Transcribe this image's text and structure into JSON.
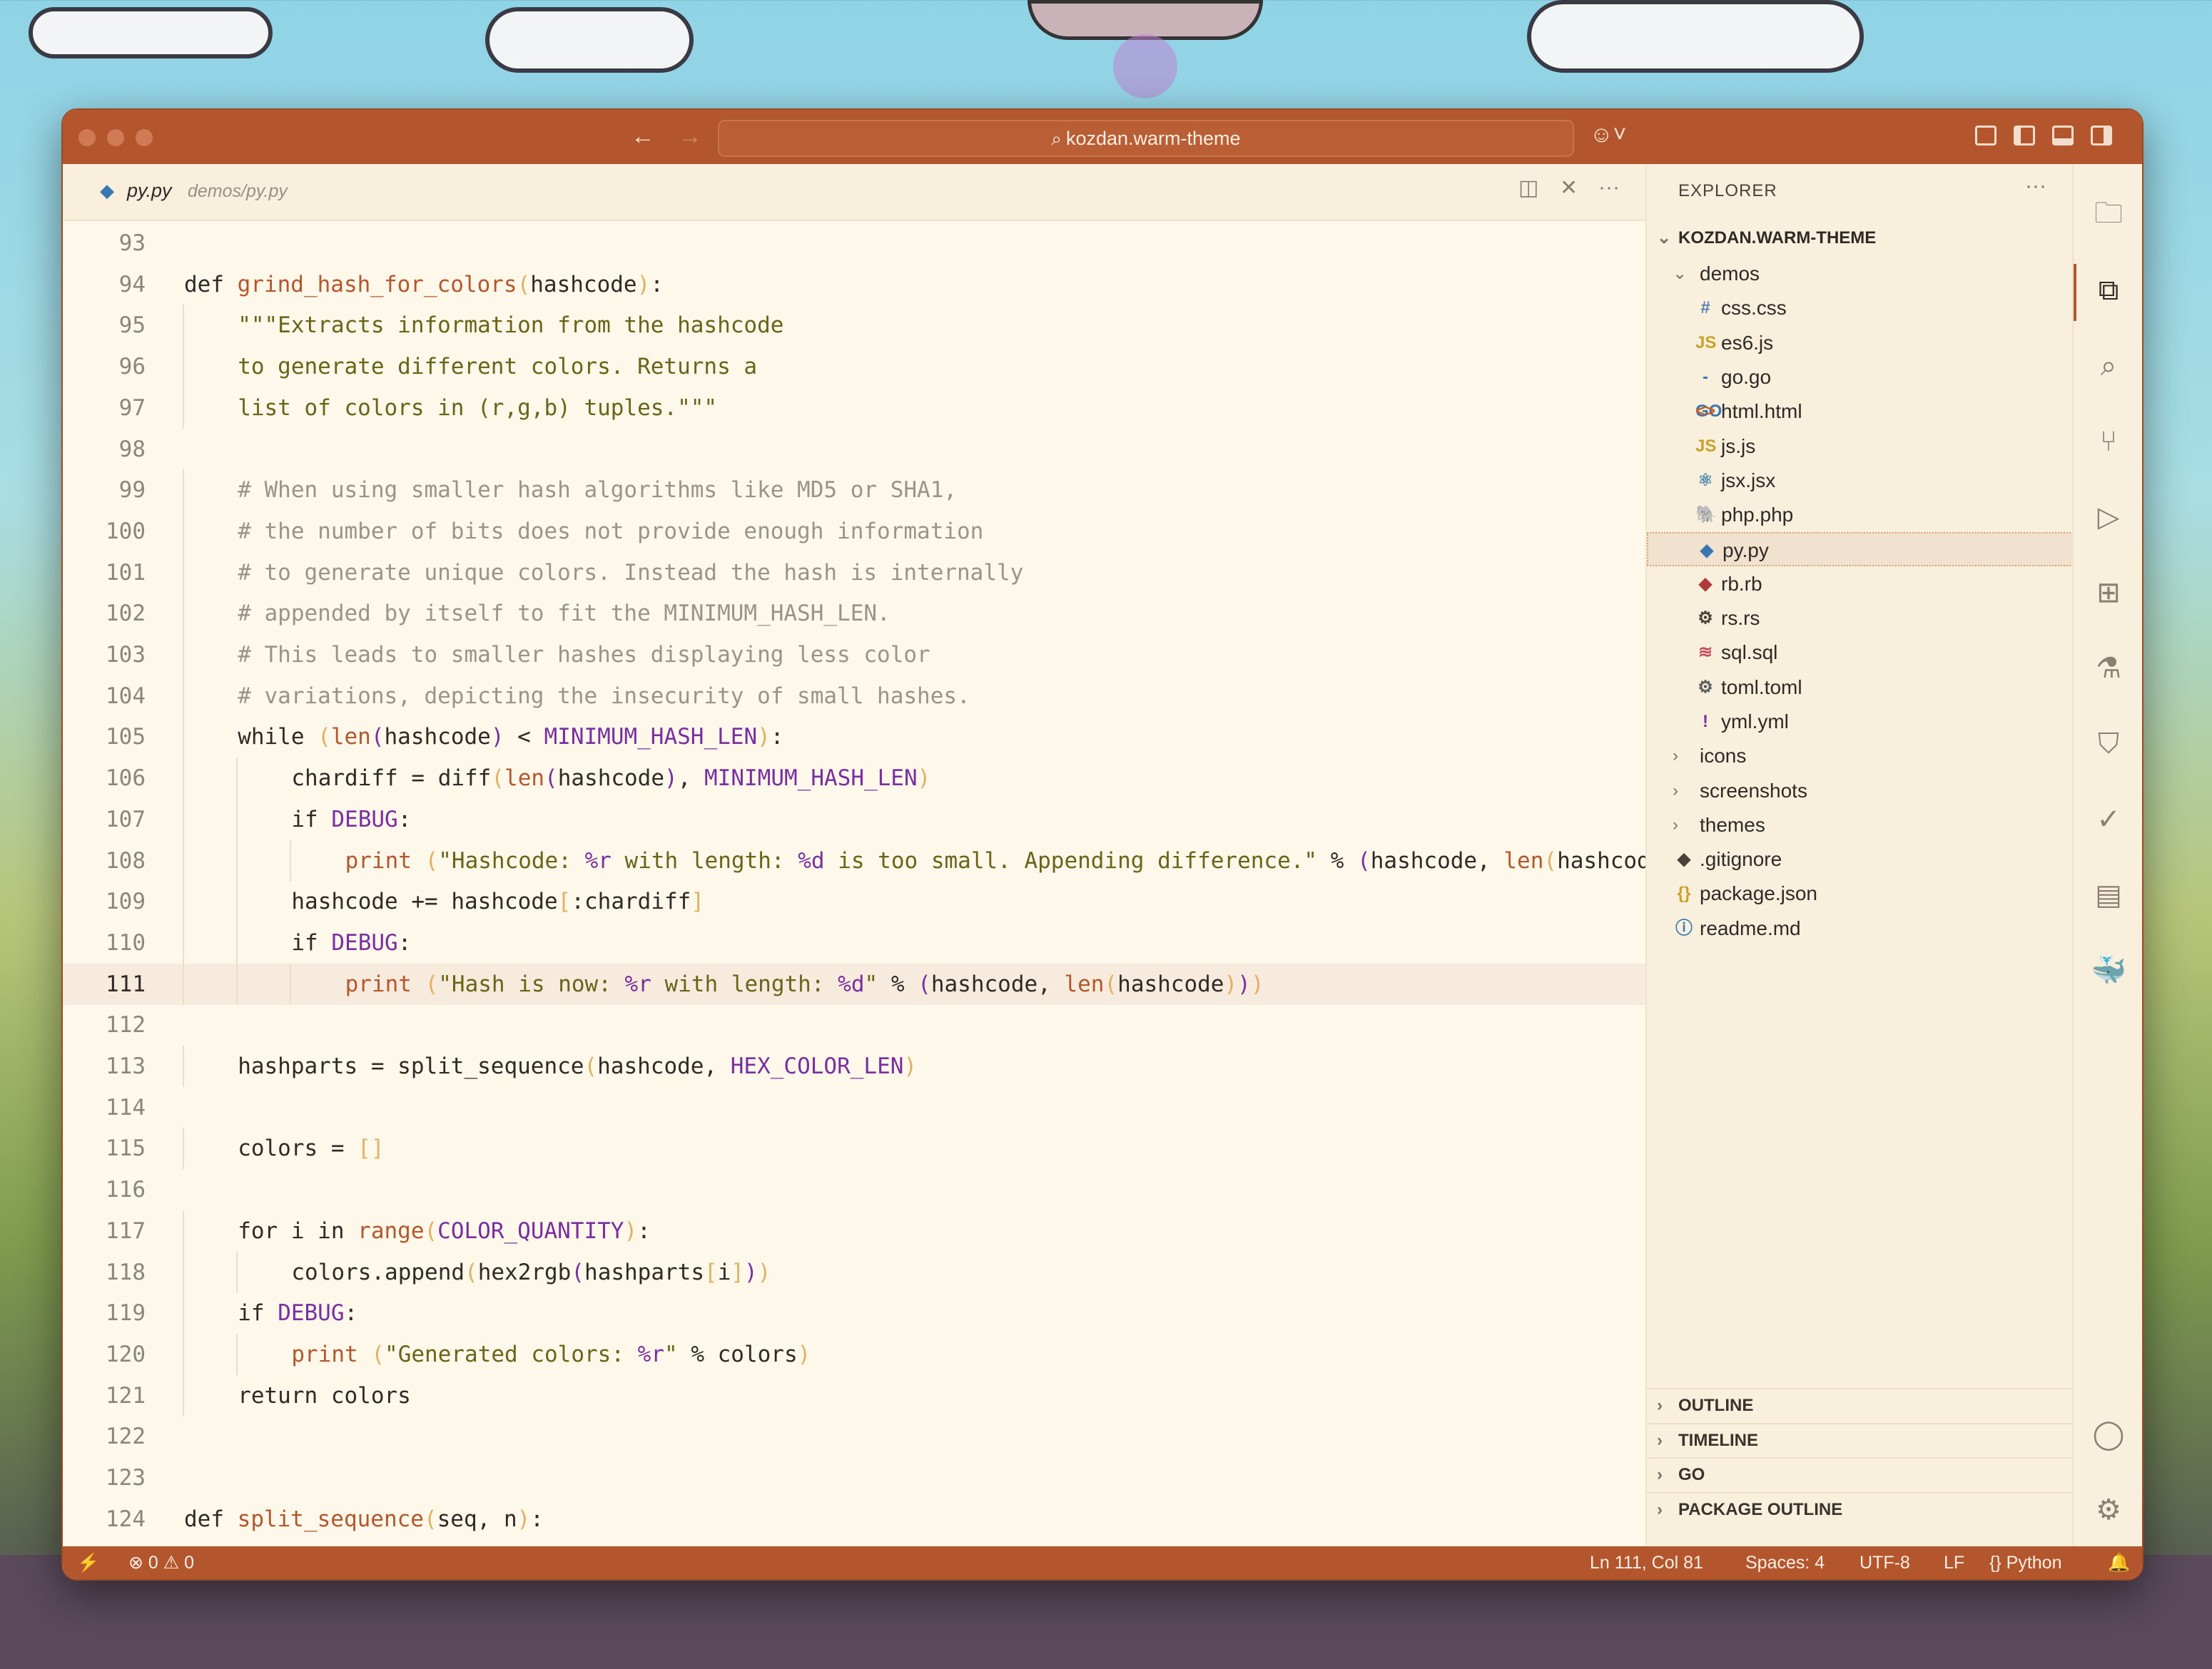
{
  "window": {
    "command_center": "kozdan.warm-theme"
  },
  "editor": {
    "tab": {
      "name": "py.py",
      "path": "demos/py.py"
    },
    "lines": [
      {
        "n": "93",
        "indent": 0,
        "segs": []
      },
      {
        "n": "94",
        "indent": 0,
        "segs": [
          [
            "k",
            "def "
          ],
          [
            "fn",
            "grind_hash_for_colors"
          ],
          [
            "br",
            "("
          ],
          [
            "pl",
            "hashcode"
          ],
          [
            "br",
            ")"
          ],
          [
            "pl",
            ":"
          ]
        ]
      },
      {
        "n": "95",
        "indent": 1,
        "segs": [
          [
            "st",
            "\"\"\"Extracts information from the hashcode"
          ]
        ]
      },
      {
        "n": "96",
        "indent": 1,
        "segs": [
          [
            "st",
            "to generate different colors. Returns a"
          ]
        ]
      },
      {
        "n": "97",
        "indent": 1,
        "segs": [
          [
            "st",
            "list of colors in (r,g,b) tuples.\"\"\""
          ]
        ]
      },
      {
        "n": "98",
        "indent": 0,
        "segs": []
      },
      {
        "n": "99",
        "indent": 1,
        "segs": [
          [
            "cm",
            "# When using smaller hash algorithms like MD5 or SHA1,"
          ]
        ]
      },
      {
        "n": "100",
        "indent": 1,
        "segs": [
          [
            "cm",
            "# the number of bits does not provide enough information"
          ]
        ]
      },
      {
        "n": "101",
        "indent": 1,
        "segs": [
          [
            "cm",
            "# to generate unique colors. Instead the hash is internally"
          ]
        ]
      },
      {
        "n": "102",
        "indent": 1,
        "segs": [
          [
            "cm",
            "# appended by itself to fit the MINIMUM_HASH_LEN."
          ]
        ]
      },
      {
        "n": "103",
        "indent": 1,
        "segs": [
          [
            "cm",
            "# This leads to smaller hashes displaying less color"
          ]
        ]
      },
      {
        "n": "104",
        "indent": 1,
        "segs": [
          [
            "cm",
            "# variations, depicting the insecurity of small hashes."
          ]
        ]
      },
      {
        "n": "105",
        "indent": 1,
        "segs": [
          [
            "k",
            "while "
          ],
          [
            "br",
            "("
          ],
          [
            "bi",
            "len"
          ],
          [
            "cst",
            "("
          ],
          [
            "pl",
            "hashcode"
          ],
          [
            "cst",
            ")"
          ],
          [
            "pl",
            " < "
          ],
          [
            "cst",
            "MINIMUM_HASH_LEN"
          ],
          [
            "br",
            ")"
          ],
          [
            "pl",
            ":"
          ]
        ]
      },
      {
        "n": "106",
        "indent": 2,
        "segs": [
          [
            "pl",
            "chardiff = diff"
          ],
          [
            "br",
            "("
          ],
          [
            "bi",
            "len"
          ],
          [
            "cst",
            "("
          ],
          [
            "pl",
            "hashcode"
          ],
          [
            "cst",
            ")"
          ],
          [
            "pl",
            ", "
          ],
          [
            "cst",
            "MINIMUM_HASH_LEN"
          ],
          [
            "br",
            ")"
          ]
        ]
      },
      {
        "n": "107",
        "indent": 2,
        "segs": [
          [
            "k",
            "if "
          ],
          [
            "cst",
            "DEBUG"
          ],
          [
            "pl",
            ":"
          ]
        ]
      },
      {
        "n": "108",
        "indent": 3,
        "segs": [
          [
            "bi",
            "print "
          ],
          [
            "br",
            "("
          ],
          [
            "st",
            "\"Hashcode: "
          ],
          [
            "cst",
            "%r"
          ],
          [
            "st",
            " with length: "
          ],
          [
            "cst",
            "%d"
          ],
          [
            "st",
            " is too small. Appending difference.\""
          ],
          [
            "pl",
            " % "
          ],
          [
            "cst",
            "("
          ],
          [
            "pl",
            "hashcode, "
          ],
          [
            "bi",
            "len"
          ],
          [
            "br",
            "("
          ],
          [
            "pl",
            "hashcode"
          ]
        ]
      },
      {
        "n": "109",
        "indent": 2,
        "segs": [
          [
            "pl",
            "hashcode += hashcode"
          ],
          [
            "br",
            "["
          ],
          [
            "pl",
            ":chardiff"
          ],
          [
            "br",
            "]"
          ]
        ]
      },
      {
        "n": "110",
        "indent": 2,
        "segs": [
          [
            "k",
            "if "
          ],
          [
            "cst",
            "DEBUG"
          ],
          [
            "pl",
            ":"
          ]
        ]
      },
      {
        "n": "111",
        "indent": 3,
        "segs": [
          [
            "bi",
            "print "
          ],
          [
            "br",
            "("
          ],
          [
            "st",
            "\"Hash is now: "
          ],
          [
            "cst",
            "%r"
          ],
          [
            "st",
            " with length: "
          ],
          [
            "cst",
            "%d"
          ],
          [
            "st",
            "\""
          ],
          [
            "pl",
            " % "
          ],
          [
            "cst",
            "("
          ],
          [
            "pl",
            "hashcode, "
          ],
          [
            "bi",
            "len"
          ],
          [
            "br",
            "("
          ],
          [
            "pl",
            "hashcode"
          ],
          [
            "br",
            ")"
          ],
          [
            "cst",
            ")"
          ],
          [
            "br",
            ")"
          ]
        ]
      },
      {
        "n": "112",
        "indent": 0,
        "segs": []
      },
      {
        "n": "113",
        "indent": 1,
        "segs": [
          [
            "pl",
            "hashparts = split_sequence"
          ],
          [
            "br",
            "("
          ],
          [
            "pl",
            "hashcode, "
          ],
          [
            "cst",
            "HEX_COLOR_LEN"
          ],
          [
            "br",
            ")"
          ]
        ]
      },
      {
        "n": "114",
        "indent": 0,
        "segs": []
      },
      {
        "n": "115",
        "indent": 1,
        "segs": [
          [
            "pl",
            "colors = "
          ],
          [
            "br",
            "[]"
          ]
        ]
      },
      {
        "n": "116",
        "indent": 0,
        "segs": []
      },
      {
        "n": "117",
        "indent": 1,
        "segs": [
          [
            "k",
            "for "
          ],
          [
            "pl",
            "i "
          ],
          [
            "k",
            "in "
          ],
          [
            "bi",
            "range"
          ],
          [
            "br",
            "("
          ],
          [
            "cst",
            "COLOR_QUANTITY"
          ],
          [
            "br",
            ")"
          ],
          [
            "pl",
            ":"
          ]
        ]
      },
      {
        "n": "118",
        "indent": 2,
        "segs": [
          [
            "pl",
            "colors.append"
          ],
          [
            "br",
            "("
          ],
          [
            "pl",
            "hex2rgb"
          ],
          [
            "cst",
            "("
          ],
          [
            "pl",
            "hashparts"
          ],
          [
            "br",
            "["
          ],
          [
            "pl",
            "i"
          ],
          [
            "br",
            "]"
          ],
          [
            "cst",
            ")"
          ],
          [
            "br",
            ")"
          ]
        ]
      },
      {
        "n": "119",
        "indent": 1,
        "segs": [
          [
            "k",
            "if "
          ],
          [
            "cst",
            "DEBUG"
          ],
          [
            "pl",
            ":"
          ]
        ]
      },
      {
        "n": "120",
        "indent": 2,
        "segs": [
          [
            "bi",
            "print "
          ],
          [
            "br",
            "("
          ],
          [
            "st",
            "\"Generated colors: "
          ],
          [
            "cst",
            "%r"
          ],
          [
            "st",
            "\""
          ],
          [
            "pl",
            " % colors"
          ],
          [
            "br",
            ")"
          ]
        ]
      },
      {
        "n": "121",
        "indent": 1,
        "segs": [
          [
            "k",
            "return "
          ],
          [
            "pl",
            "colors"
          ]
        ]
      },
      {
        "n": "122",
        "indent": 0,
        "segs": []
      },
      {
        "n": "123",
        "indent": 0,
        "segs": []
      },
      {
        "n": "124",
        "indent": 0,
        "segs": [
          [
            "k",
            "def "
          ],
          [
            "fn",
            "split_sequence"
          ],
          [
            "br",
            "("
          ],
          [
            "pl",
            "seq, n"
          ],
          [
            "br",
            ")"
          ],
          [
            "pl",
            ":"
          ]
        ]
      }
    ],
    "active_line": "111"
  },
  "explorer": {
    "title": "EXPLORER",
    "root": "KOZDAN.WARM-THEME",
    "items": [
      {
        "label": "demos",
        "type": "folder-open",
        "icon": "",
        "depth": 1
      },
      {
        "label": "css.css",
        "type": "file",
        "icon": "#",
        "icon_color": "#5a7fb0",
        "depth": 2
      },
      {
        "label": "es6.js",
        "type": "file",
        "icon": "JS",
        "icon_color": "#c9a227",
        "depth": 2
      },
      {
        "label": "go.go",
        "type": "file",
        "icon": "-GO",
        "icon_color": "#3a77b0",
        "depth": 2
      },
      {
        "label": "html.html",
        "type": "file",
        "icon": "<>",
        "icon_color": "#c9602c",
        "depth": 2
      },
      {
        "label": "js.js",
        "type": "file",
        "icon": "JS",
        "icon_color": "#c9a227",
        "depth": 2
      },
      {
        "label": "jsx.jsx",
        "type": "file",
        "icon": "⚛",
        "icon_color": "#5a8fb0",
        "depth": 2
      },
      {
        "label": "php.php",
        "type": "file",
        "icon": "🐘",
        "icon_color": "#8a5ab0",
        "depth": 2
      },
      {
        "label": "py.py",
        "type": "file",
        "icon": "◆",
        "icon_color": "#3a77b0",
        "depth": 2,
        "selected": true
      },
      {
        "label": "rb.rb",
        "type": "file",
        "icon": "◆",
        "icon_color": "#b03a3a",
        "depth": 2
      },
      {
        "label": "rs.rs",
        "type": "file",
        "icon": "⚙",
        "icon_color": "#4a423a",
        "depth": 2
      },
      {
        "label": "sql.sql",
        "type": "file",
        "icon": "≋",
        "icon_color": "#c94a5a",
        "depth": 2
      },
      {
        "label": "toml.toml",
        "type": "file",
        "icon": "⚙",
        "icon_color": "#5a5a5a",
        "depth": 2
      },
      {
        "label": "yml.yml",
        "type": "file",
        "icon": "!",
        "icon_color": "#7a2fa0",
        "depth": 2
      },
      {
        "label": "icons",
        "type": "folder",
        "icon": "",
        "depth": 1
      },
      {
        "label": "screenshots",
        "type": "folder",
        "icon": "",
        "depth": 1
      },
      {
        "label": "themes",
        "type": "folder",
        "icon": "",
        "depth": 1
      },
      {
        "label": ".gitignore",
        "type": "file",
        "icon": "◆",
        "icon_color": "#4a423a",
        "depth": 1
      },
      {
        "label": "package.json",
        "type": "file",
        "icon": "{}",
        "icon_color": "#c9a227",
        "depth": 1
      },
      {
        "label": "readme.md",
        "type": "file",
        "icon": "ⓘ",
        "icon_color": "#3a77b0",
        "depth": 1
      }
    ],
    "sections": [
      "OUTLINE",
      "TIMELINE",
      "GO",
      "PACKAGE OUTLINE"
    ]
  },
  "status": {
    "errors": "0",
    "warnings": "0",
    "position": "Ln 111, Col 81",
    "spaces": "Spaces: 4",
    "encoding": "UTF-8",
    "eol": "LF",
    "language": "Python"
  }
}
